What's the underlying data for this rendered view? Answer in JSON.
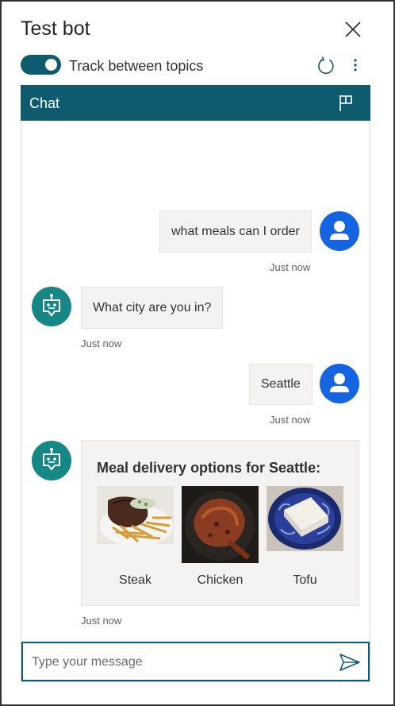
{
  "header": {
    "title": "Test bot"
  },
  "toggle": {
    "label": "Track between topics",
    "on": true
  },
  "chat": {
    "header_label": "Chat",
    "messages": [
      {
        "from": "user",
        "text": "what meals can I order",
        "time": "Just now"
      },
      {
        "from": "bot",
        "text": "What city are you in?",
        "time": "Just now"
      },
      {
        "from": "user",
        "text": "Seattle",
        "time": "Just now"
      }
    ],
    "card": {
      "title": "Meal delivery options for Seattle:",
      "items": [
        {
          "label": "Steak",
          "image": "steak-photo"
        },
        {
          "label": "Chicken",
          "image": "roast-chicken-photo"
        },
        {
          "label": "Tofu",
          "image": "tofu-photo"
        }
      ],
      "time": "Just now"
    }
  },
  "composer": {
    "placeholder": "Type your message"
  },
  "colors": {
    "accent": "#0e5a6e",
    "user_avatar": "#1565e3",
    "bot_avatar": "#168784",
    "bubble": "#f4f3f2"
  }
}
